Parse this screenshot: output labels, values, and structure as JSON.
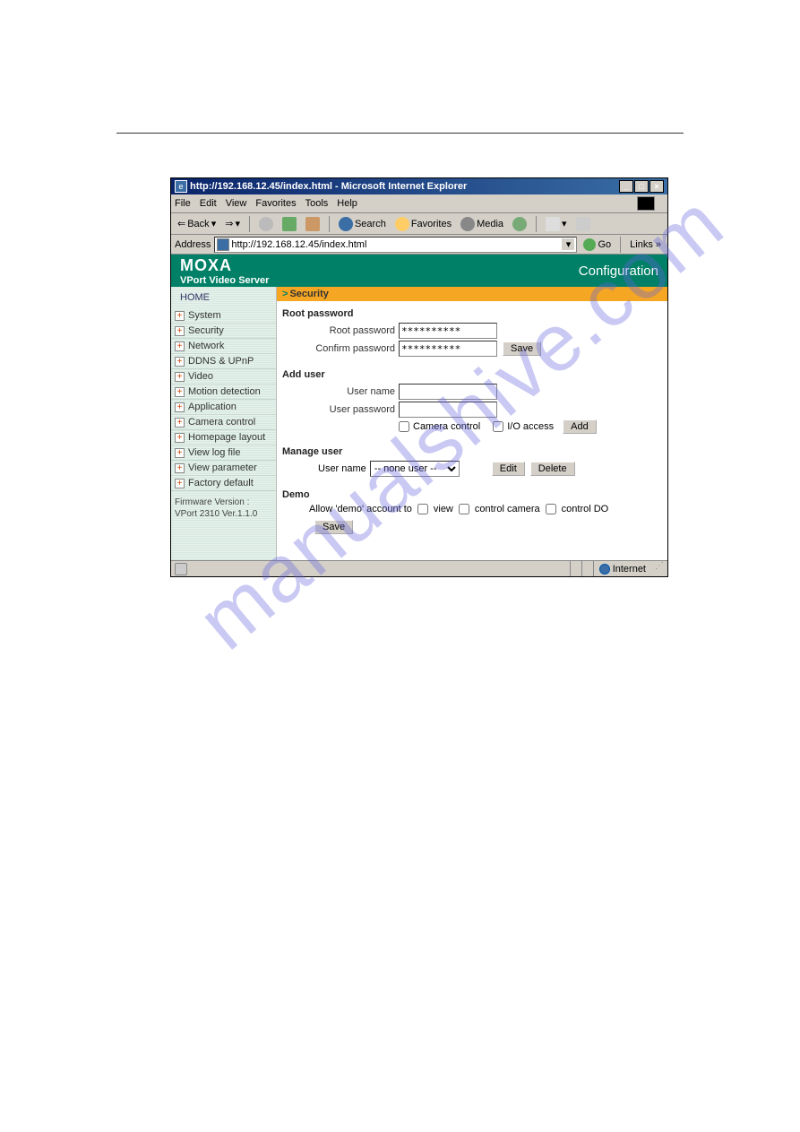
{
  "window": {
    "title": "http://192.168.12.45/index.html - Microsoft Internet Explorer",
    "min": "_",
    "max": "□",
    "close": "×"
  },
  "menu": {
    "file": "File",
    "edit": "Edit",
    "view": "View",
    "favorites": "Favorites",
    "tools": "Tools",
    "help": "Help"
  },
  "toolbar": {
    "back": "Back",
    "search": "Search",
    "favorites": "Favorites",
    "media": "Media"
  },
  "addressbar": {
    "label": "Address",
    "value": "http://192.168.12.45/index.html",
    "go": "Go",
    "links": "Links »"
  },
  "app": {
    "brand": "MOXA",
    "subtitle": "VPort Video Server",
    "headerRight": "Configuration"
  },
  "sidebar": {
    "home": "HOME",
    "items": [
      "System",
      "Security",
      "Network",
      "DDNS & UPnP",
      "Video",
      "Motion detection",
      "Application",
      "Camera control",
      "Homepage layout",
      "View log file",
      "View parameter",
      "Factory default"
    ],
    "fw1": "Firmware Version :",
    "fw2": "VPort 2310 Ver.1.1.0"
  },
  "page": {
    "breadcrumbGt": ">",
    "breadcrumb": "Security",
    "rootPw": {
      "heading": "Root password",
      "rootLabel": "Root password",
      "confirmLabel": "Confirm password",
      "value": "**********",
      "save": "Save"
    },
    "addUser": {
      "heading": "Add user",
      "userName": "User name",
      "userPw": "User password",
      "camCtrl": "Camera control",
      "ioAccess": "I/O access",
      "add": "Add"
    },
    "manageUser": {
      "heading": "Manage user",
      "userName": "User name",
      "selected": "-- none user --",
      "edit": "Edit",
      "delete": "Delete"
    },
    "demo": {
      "heading": "Demo",
      "allow": "Allow 'demo' account to",
      "view": "view",
      "controlCamera": "control camera",
      "controlDO": "control DO",
      "save": "Save"
    }
  },
  "status": {
    "zone": "Internet"
  }
}
